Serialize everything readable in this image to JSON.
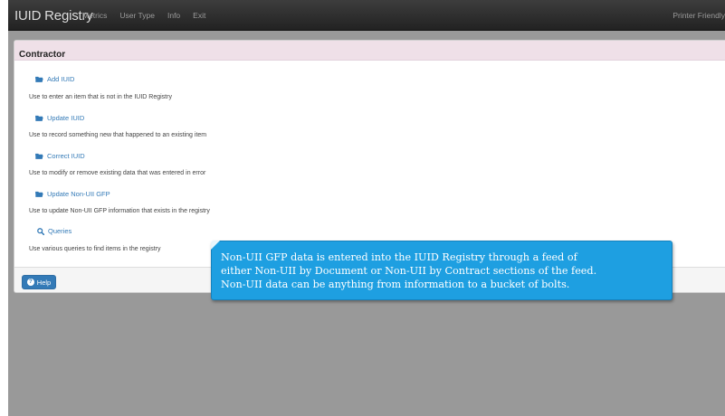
{
  "navbar": {
    "brand": "IUID Registry",
    "links": [
      "Metrics",
      "User Type",
      "Info",
      "Exit"
    ],
    "printer_friendly": "Printer Friendly"
  },
  "panel": {
    "title": "Contractor",
    "actions": [
      {
        "label": "Add IUID",
        "icon": "folder-open-icon",
        "description": "Use to enter an item that is not in the IUID Registry"
      },
      {
        "label": "Update IUID",
        "icon": "folder-open-icon",
        "description": "Use to record something new that happened to an existing item"
      },
      {
        "label": "Correct IUID",
        "icon": "folder-open-icon",
        "description": "Use to modify or remove existing data that was entered in error"
      },
      {
        "label": "Update Non-UII GFP",
        "icon": "folder-open-icon",
        "description": "Use to update Non-UII GFP information that exists in the registry"
      },
      {
        "label": "Queries",
        "icon": "search-icon",
        "description": "Use various queries to find items in the registry"
      }
    ],
    "help_button": "Help"
  },
  "callout": {
    "text": "Non-UII GFP data is entered into the IUID Registry through a feed of\neither Non-UII by Document or Non-UII by Contract sections of the feed.\nNon-UII data can be anything from information to a bucket of bolts."
  },
  "colors": {
    "navbar": "#2b2b2b",
    "panel_heading": "#efe0e8",
    "link": "#337ab7",
    "callout": "#1e9fe1",
    "background": "#999999"
  }
}
